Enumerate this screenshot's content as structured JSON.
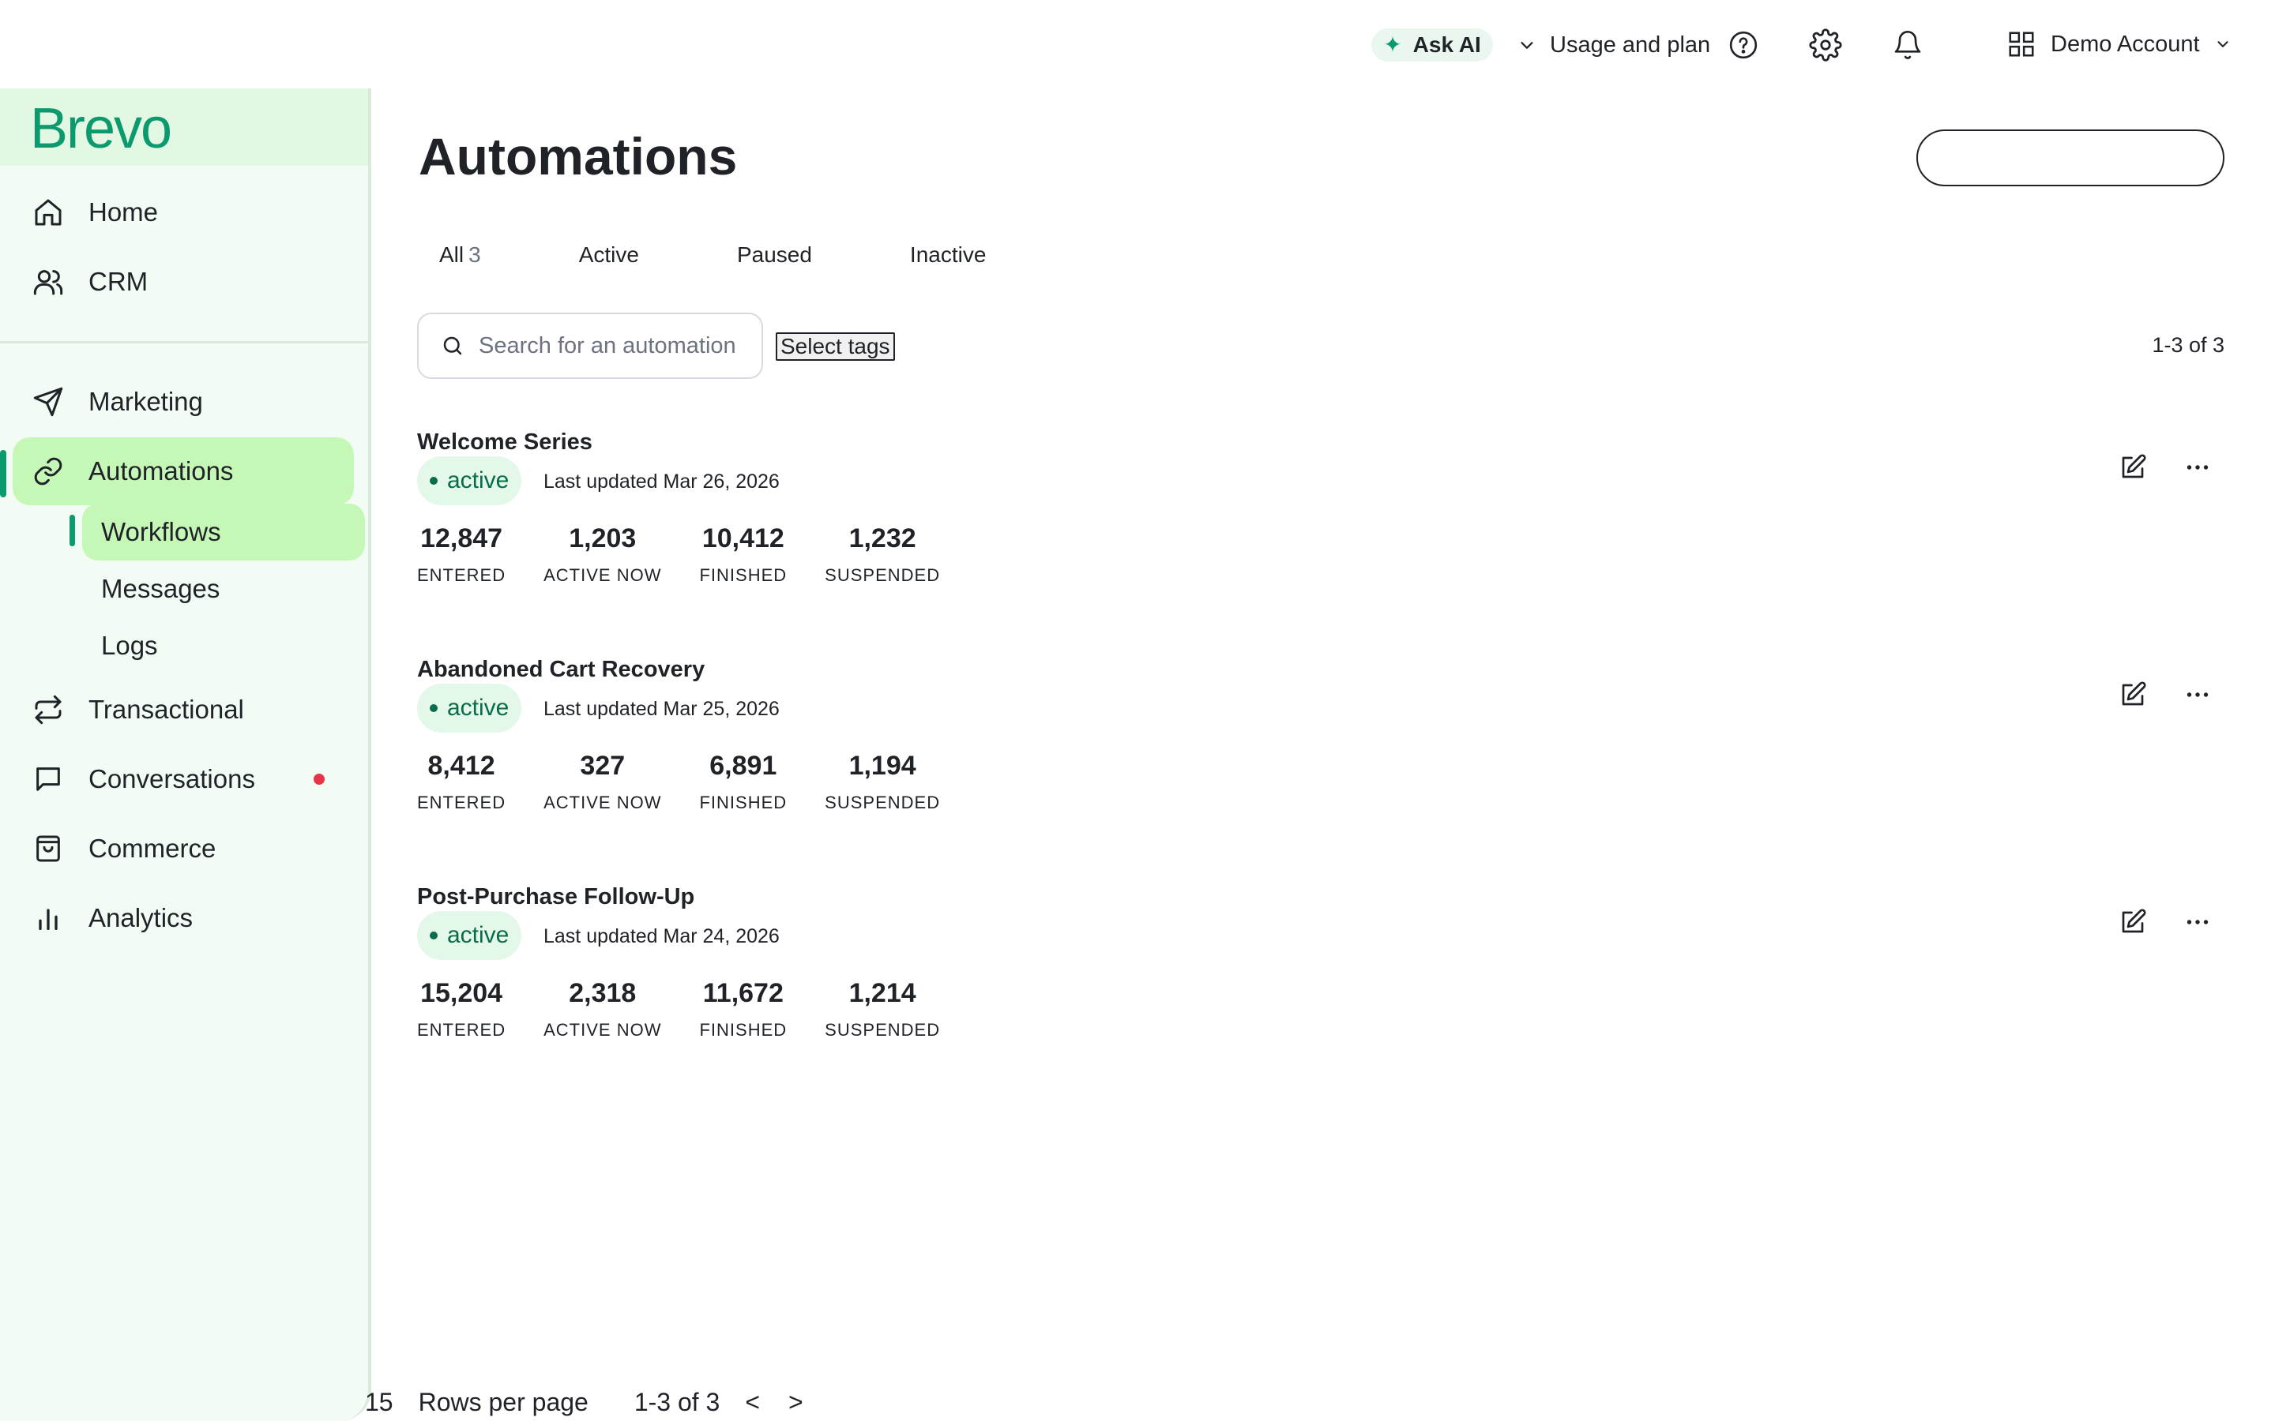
{
  "topbar": {
    "ask_ai": "Ask AI",
    "usage": "Usage and plan",
    "account": "Demo Account",
    "icons": [
      "sparkle-icon",
      "chevron-down-icon",
      "help-icon",
      "gear-icon",
      "bell-icon",
      "grid-icon"
    ]
  },
  "sidebar": {
    "brand": "Brevo",
    "items": [
      {
        "label": "Home",
        "icon": "home-icon"
      },
      {
        "label": "CRM",
        "icon": "users-icon"
      },
      {
        "label": "Marketing",
        "icon": "send-icon"
      },
      {
        "label": "Automations",
        "icon": "link-icon",
        "active": true
      },
      {
        "label": "Transactional",
        "icon": "repeat-icon"
      },
      {
        "label": "Conversations",
        "icon": "chat-icon"
      },
      {
        "label": "Commerce",
        "icon": "bag-icon"
      },
      {
        "label": "Analytics",
        "icon": "bar-chart-icon"
      }
    ],
    "subitems": [
      {
        "label": "Workflows",
        "active": true
      },
      {
        "label": "Messages"
      },
      {
        "label": "Logs"
      }
    ]
  },
  "main": {
    "title": "Automations",
    "tabs": [
      {
        "label": "All",
        "count": "3"
      },
      {
        "label": "Active"
      },
      {
        "label": "Paused"
      },
      {
        "label": "Inactive"
      }
    ],
    "search_placeholder": "Search for an automation",
    "select_tags": "Select tags",
    "range": "1-3 of 3",
    "automations": [
      {
        "name": "Welcome Series",
        "status": "active",
        "updated": "Last updated Mar 26, 2026",
        "stats": [
          {
            "value": "12,847",
            "label": "ENTERED"
          },
          {
            "value": "1,203",
            "label": "ACTIVE NOW"
          },
          {
            "value": "10,412",
            "label": "FINISHED"
          },
          {
            "value": "1,232",
            "label": "SUSPENDED"
          }
        ]
      },
      {
        "name": "Abandoned Cart Recovery",
        "status": "active",
        "updated": "Last updated Mar 25, 2026",
        "stats": [
          {
            "value": "8,412",
            "label": "ENTERED"
          },
          {
            "value": "327",
            "label": "ACTIVE NOW"
          },
          {
            "value": "6,891",
            "label": "FINISHED"
          },
          {
            "value": "1,194",
            "label": "SUSPENDED"
          }
        ]
      },
      {
        "name": "Post-Purchase Follow-Up",
        "status": "active",
        "updated": "Last updated Mar 24, 2026",
        "stats": [
          {
            "value": "15,204",
            "label": "ENTERED"
          },
          {
            "value": "2,318",
            "label": "ACTIVE NOW"
          },
          {
            "value": "11,672",
            "label": "FINISHED"
          },
          {
            "value": "1,214",
            "label": "SUSPENDED"
          }
        ]
      }
    ]
  },
  "pager": {
    "rows": "15",
    "rows_label": "Rows per page",
    "range": "1-3 of 3",
    "prev": "<",
    "next": ">"
  },
  "colors": {
    "brand": "#0b996e",
    "active_nav": "#c5f7b7",
    "sidebar_bg": "#f3fcf4",
    "badge_bg": "#e3f8e8",
    "notification_dot": "#e8334a"
  }
}
